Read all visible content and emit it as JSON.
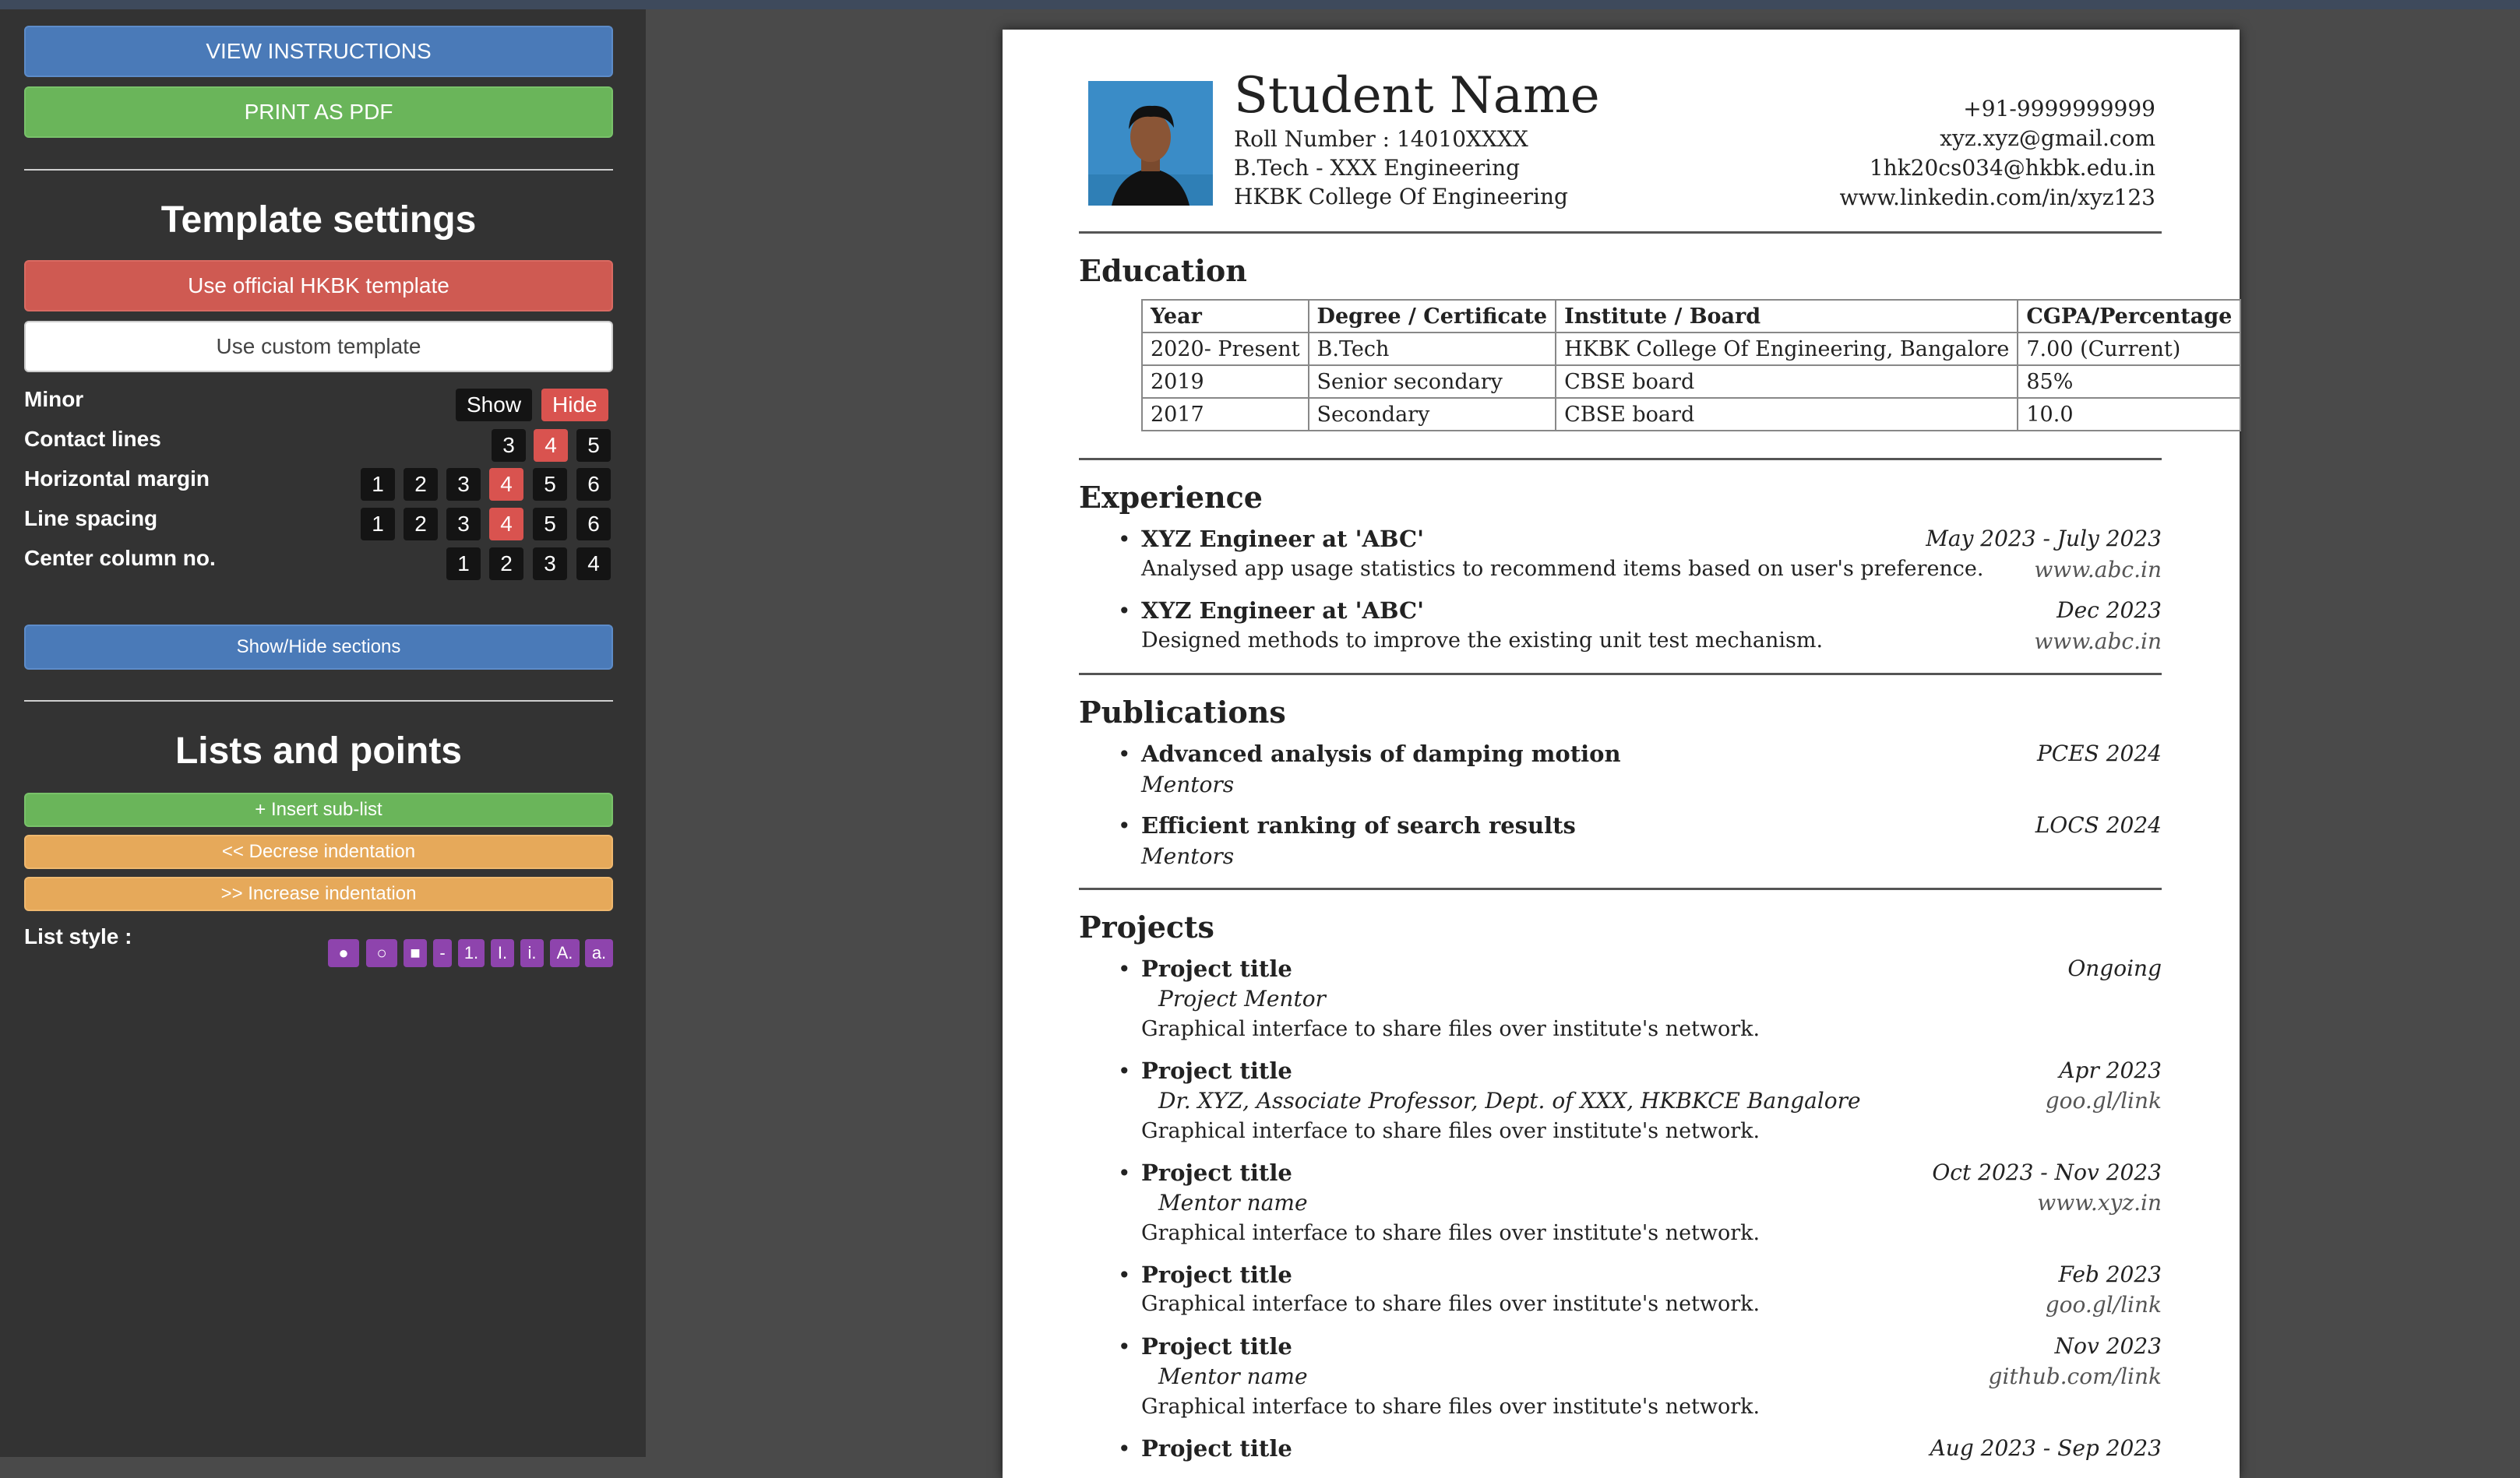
{
  "sidebar": {
    "view_instructions": "VIEW INSTRUCTIONS",
    "print_pdf": "PRINT AS PDF",
    "template_title": "Template settings",
    "official_template": "Use official HKBK template",
    "custom_template": "Use custom template",
    "minor_label": "Minor",
    "minor_show": "Show",
    "minor_hide": "Hide",
    "contact_label": "Contact lines",
    "contact_opts": [
      "3",
      "4",
      "5"
    ],
    "hmargin_label": "Horizontal margin",
    "hmargin_opts": [
      "1",
      "2",
      "3",
      "4",
      "5",
      "6"
    ],
    "spacing_label": "Line spacing",
    "spacing_opts": [
      "1",
      "2",
      "3",
      "4",
      "5",
      "6"
    ],
    "center_label": "Center column no.",
    "center_opts": [
      "1",
      "2",
      "3",
      "4"
    ],
    "show_hide_sections": "Show/Hide sections",
    "lists_title": "Lists and points",
    "insert_sublist": "+ Insert sub-list",
    "decrease_indent": "<< Decrese indentation",
    "increase_indent": ">> Increase indentation",
    "list_style_label": "List style :",
    "list_styles": [
      "●",
      "○",
      "■",
      "-",
      "1.",
      "I.",
      "i.",
      "A.",
      "a."
    ]
  },
  "resume": {
    "name": "Student Name",
    "roll": "Roll Number : 14010XXXX",
    "degree": "B.Tech - XXX Engineering",
    "college": "HKBK College Of Engineering",
    "phone": "+91-9999999999",
    "email1": "xyz.xyz@gmail.com",
    "email2": "1hk20cs034@hkbk.edu.in",
    "linkedin": "www.linkedin.com/in/xyz123",
    "education": {
      "heading": "Education",
      "headers": [
        "Year",
        "Degree / Certificate",
        "Institute / Board",
        "CGPA/Percentage"
      ],
      "rows": [
        [
          "2020- Present",
          "B.Tech",
          "HKBK College Of Engineering, Bangalore",
          "7.00 (Current)"
        ],
        [
          "2019",
          "Senior secondary",
          "CBSE board",
          "85%"
        ],
        [
          "2017",
          "Secondary",
          "CBSE board",
          "10.0"
        ]
      ]
    },
    "experience": {
      "heading": "Experience",
      "items": [
        {
          "title": "XYZ Engineer at 'ABC'",
          "date": "May 2023 - July 2023",
          "desc": "Analysed app usage statistics to recommend items based on user's preference.",
          "link": "www.abc.in"
        },
        {
          "title": "XYZ Engineer at 'ABC'",
          "date": "Dec 2023",
          "desc": "Designed methods to improve the existing unit test mechanism.",
          "link": "www.abc.in"
        }
      ]
    },
    "publications": {
      "heading": "Publications",
      "items": [
        {
          "title": "Advanced analysis of damping motion",
          "venue": "PCES 2024",
          "sub": "Mentors"
        },
        {
          "title": "Efficient ranking of search results",
          "venue": "LOCS 2024",
          "sub": "Mentors"
        }
      ]
    },
    "projects": {
      "heading": "Projects",
      "items": [
        {
          "title": "Project title",
          "date": "Ongoing",
          "mentor": "Project Mentor",
          "desc": "Graphical interface to share files over institute's network.",
          "link": ""
        },
        {
          "title": "Project title",
          "date": "Apr 2023",
          "mentor": "Dr. XYZ, Associate Professor, Dept. of XXX, HKBKCE Bangalore",
          "desc": "Graphical interface to share files over institute's network.",
          "link": "goo.gl/link"
        },
        {
          "title": "Project title",
          "date": "Oct 2023 - Nov 2023",
          "mentor": "Mentor name",
          "desc": "Graphical interface to share files over institute's network.",
          "link": "www.xyz.in"
        },
        {
          "title": "Project title",
          "date": "Feb 2023",
          "mentor": "",
          "desc": "Graphical interface to share files over institute's network.",
          "link": "goo.gl/link"
        },
        {
          "title": "Project title",
          "date": "Nov 2023",
          "mentor": "Mentor name",
          "desc": "Graphical interface to share files over institute's network.",
          "link": "github.com/link"
        },
        {
          "title": "Project title",
          "date": "Aug 2023 - Sep 2023",
          "mentor": "",
          "desc": "",
          "link": ""
        }
      ]
    }
  }
}
